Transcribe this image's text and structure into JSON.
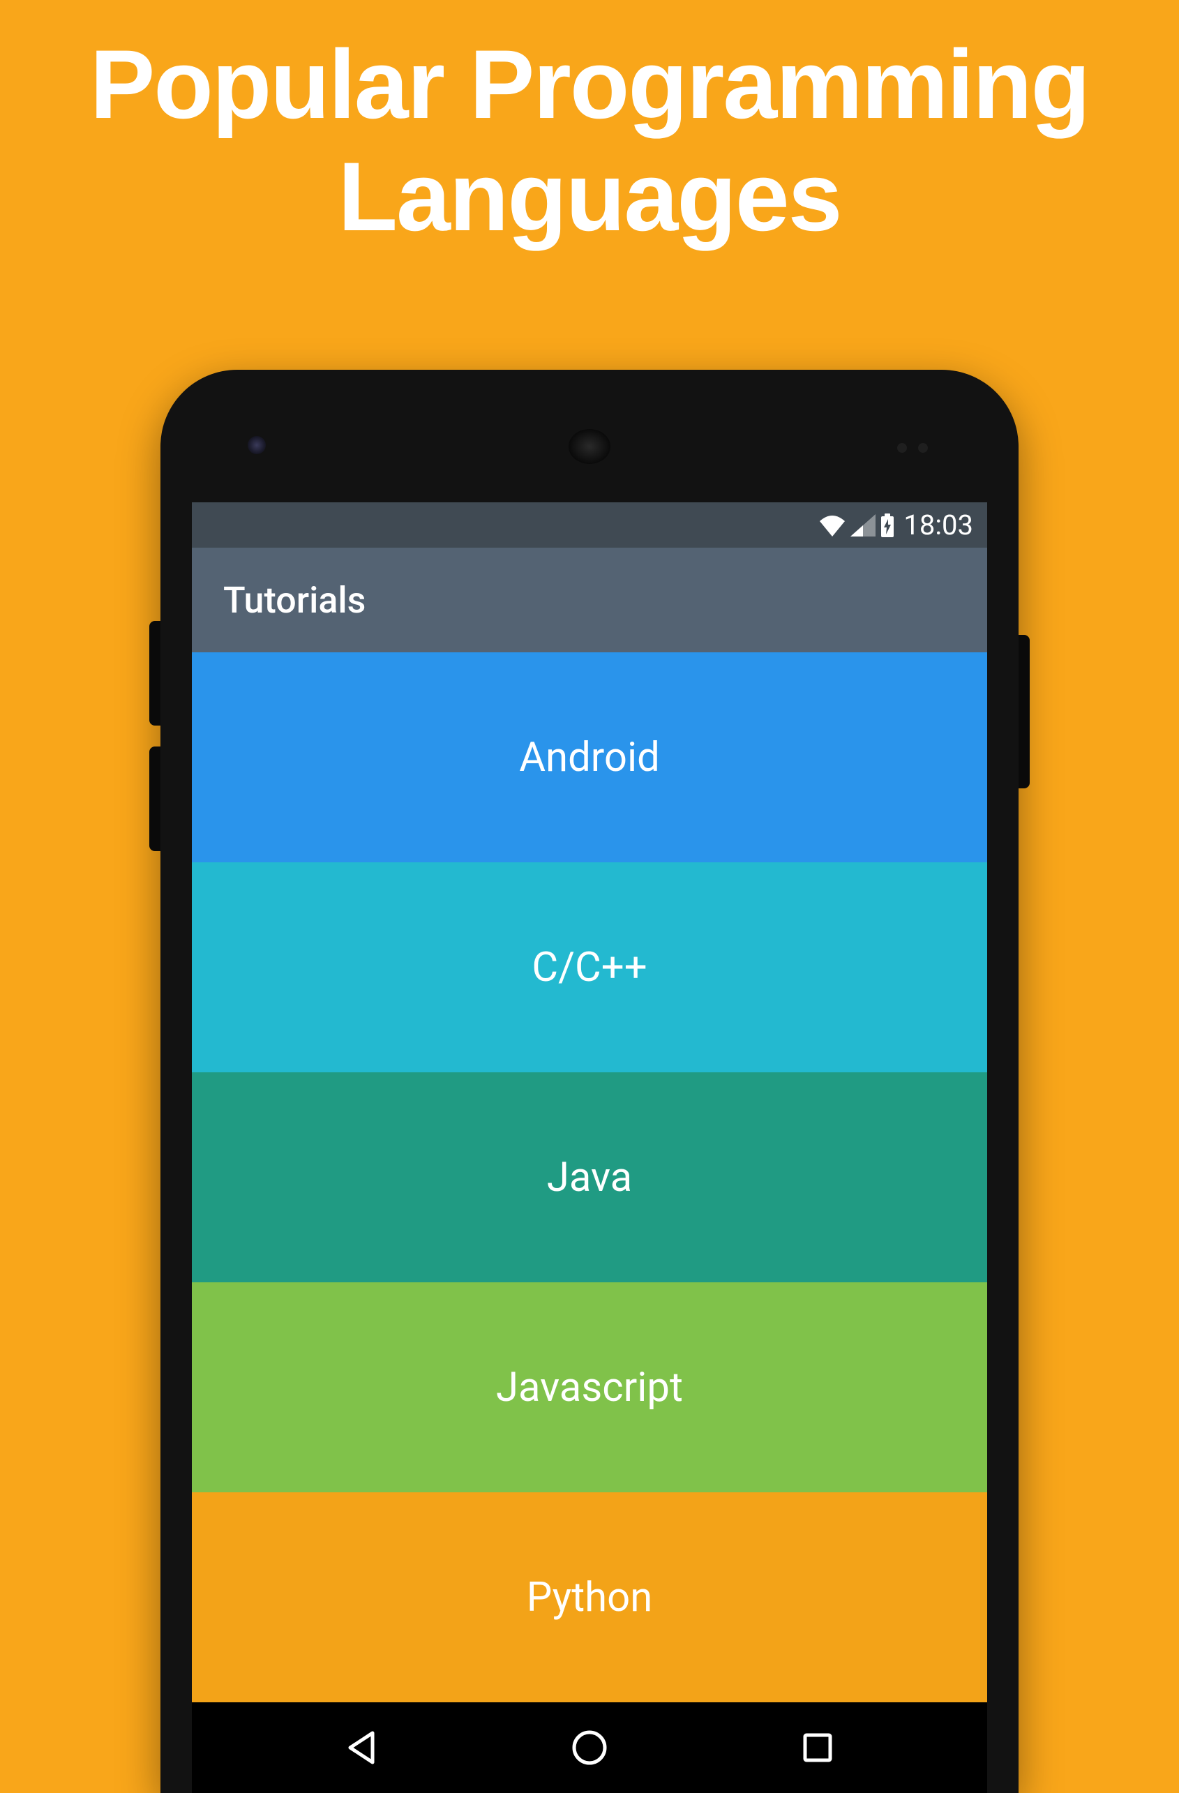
{
  "page": {
    "title": "Popular Programming Languages"
  },
  "statusbar": {
    "time": "18:03"
  },
  "appbar": {
    "title": "Tutorials"
  },
  "list": {
    "items": [
      {
        "label": "Android",
        "color": "#2A94EB"
      },
      {
        "label": "C/C++",
        "color": "#23B9D0"
      },
      {
        "label": "Java",
        "color": "#209B83"
      },
      {
        "label": "Javascript",
        "color": "#80C24A"
      },
      {
        "label": "Python",
        "color": "#F3A318"
      }
    ]
  }
}
